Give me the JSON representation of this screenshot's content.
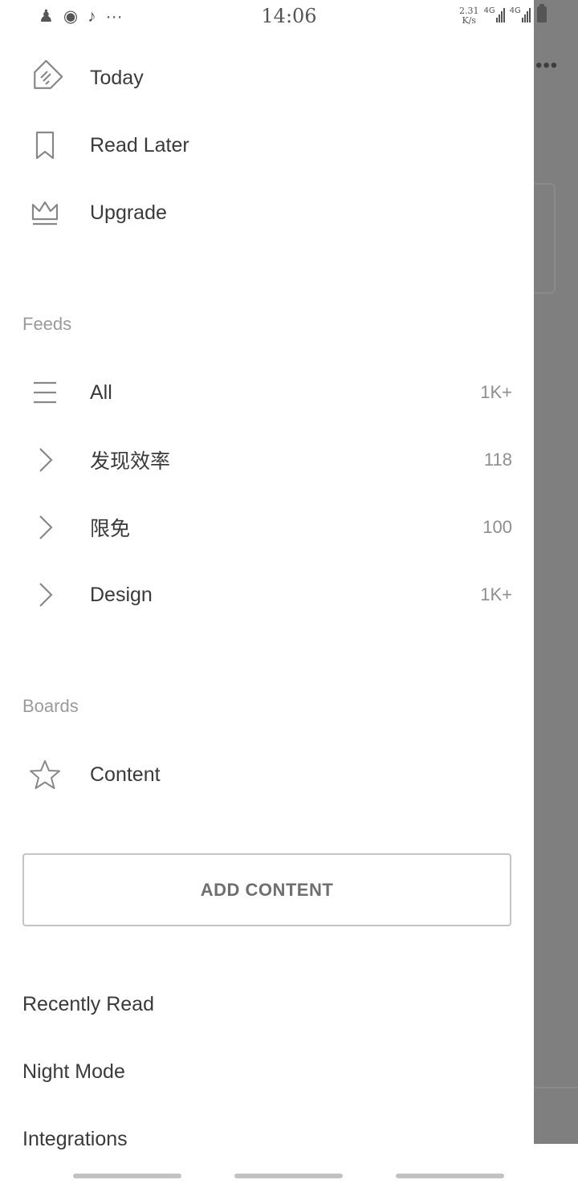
{
  "status_bar": {
    "time": "14:06",
    "speed_value": "2.31",
    "speed_unit": "K/s",
    "network_1": "4G",
    "network_2": "4G",
    "left_icons": [
      "notification-icon",
      "weibo-icon",
      "tiktok-icon",
      "more-icon"
    ]
  },
  "drawer": {
    "primary": [
      {
        "label": "Today",
        "icon": "today-tag-icon"
      },
      {
        "label": "Read Later",
        "icon": "bookmark-icon"
      },
      {
        "label": "Upgrade",
        "icon": "crown-icon"
      }
    ],
    "feeds_header": "Feeds",
    "feeds": [
      {
        "label": "All",
        "count": "1K+",
        "icon": "list-icon"
      },
      {
        "label": "发现效率",
        "count": "118",
        "icon": "chevron-right-icon"
      },
      {
        "label": "限免",
        "count": "100",
        "icon": "chevron-right-icon"
      },
      {
        "label": "Design",
        "count": "1K+",
        "icon": "chevron-right-icon"
      }
    ],
    "boards_header": "Boards",
    "boards": [
      {
        "label": "Content",
        "icon": "star-icon"
      }
    ],
    "add_content_label": "ADD CONTENT",
    "menu": [
      "Recently Read",
      "Night Mode",
      "Integrations"
    ]
  },
  "colors": {
    "background": "#ffffff",
    "scrim": "#7f7f7f",
    "text": "#3a3a3a",
    "muted": "#9a9a9a"
  }
}
